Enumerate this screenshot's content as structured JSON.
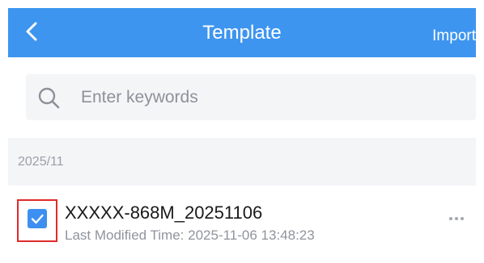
{
  "header": {
    "back_icon": "chevron-left-icon",
    "title": "Template",
    "import_label": "Import",
    "background_color": "#3d95ef"
  },
  "search": {
    "icon": "search-icon",
    "placeholder": "Enter keywords"
  },
  "section": {
    "label": "2025/11"
  },
  "items": [
    {
      "name": "XXXXX-868M_20251106",
      "subtitle": "Last Modified Time: 2025-11-06 13:48:23",
      "checked": true,
      "more_icon": "more-horizontal-icon"
    }
  ],
  "colors": {
    "accent": "#3d8ff0",
    "highlight_border": "#e02a2a"
  }
}
